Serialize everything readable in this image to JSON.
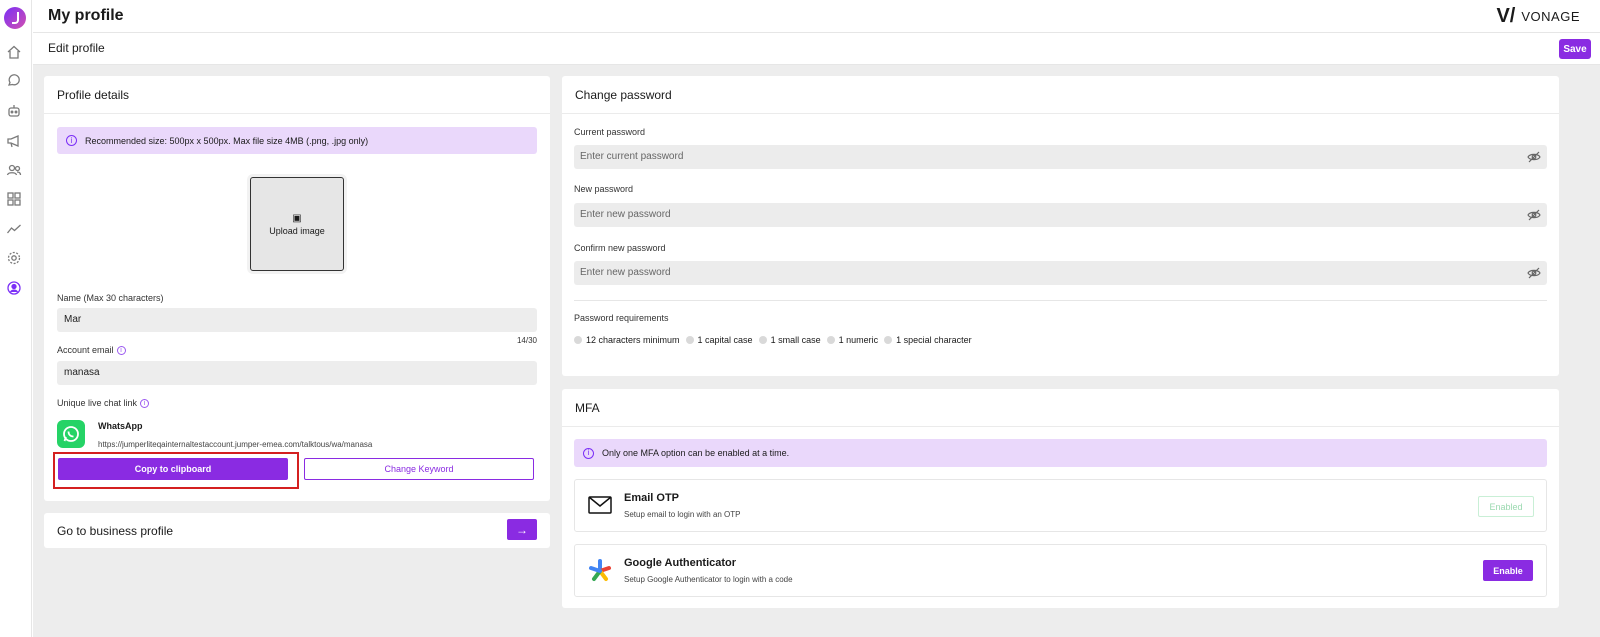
{
  "header": {
    "title": "My profile",
    "brand_mark": "V/",
    "brand_name": "VONAGE",
    "subtitle": "Edit profile",
    "save_label": "Save"
  },
  "rail": {
    "icons": [
      "home-icon",
      "chat-icon",
      "bot-icon",
      "megaphone-icon",
      "contacts-icon",
      "apps-icon",
      "analytics-icon",
      "settings-icon",
      "profile-icon"
    ]
  },
  "profile": {
    "title": "Profile details",
    "banner": "Recommended size: 500px x 500px. Max file size 4MB (.png, .jpg only)",
    "upload_label": "Upload image",
    "name_label": "Name (Max 30 characters)",
    "name_value": "Mar",
    "name_counter": "14/30",
    "email_label": "Account email",
    "email_value": "manasa",
    "link_label": "Unique live chat link",
    "channel_name": "WhatsApp",
    "channel_link": "https://jumperliteqainternaltestaccount.jumper-emea.com/talktous/wa/manasa",
    "copy_label": "Copy to clipboard",
    "change_keyword_label": "Change Keyword"
  },
  "business": {
    "label": "Go to business profile",
    "arrow": "→"
  },
  "password": {
    "title": "Change password",
    "current_label": "Current password",
    "current_placeholder": "Enter current password",
    "new_label": "New password",
    "new_placeholder": "Enter new password",
    "confirm_label": "Confirm new password",
    "confirm_placeholder": "Enter new password",
    "requirements_label": "Password requirements",
    "requirements": [
      "12 characters minimum",
      "1 capital case",
      "1 small case",
      "1 numeric",
      "1 special character"
    ]
  },
  "mfa": {
    "title": "MFA",
    "banner": "Only one MFA option can be enabled at a time.",
    "email_title": "Email OTP",
    "email_desc": "Setup email to login with an OTP",
    "email_status": "Enabled",
    "google_title": "Google Authenticator",
    "google_desc": "Setup Google Authenticator to login with a code",
    "google_action": "Enable"
  },
  "colors": {
    "accent": "#8a2be2",
    "banner_bg": "#ead8fb",
    "highlight": "#d42020"
  }
}
